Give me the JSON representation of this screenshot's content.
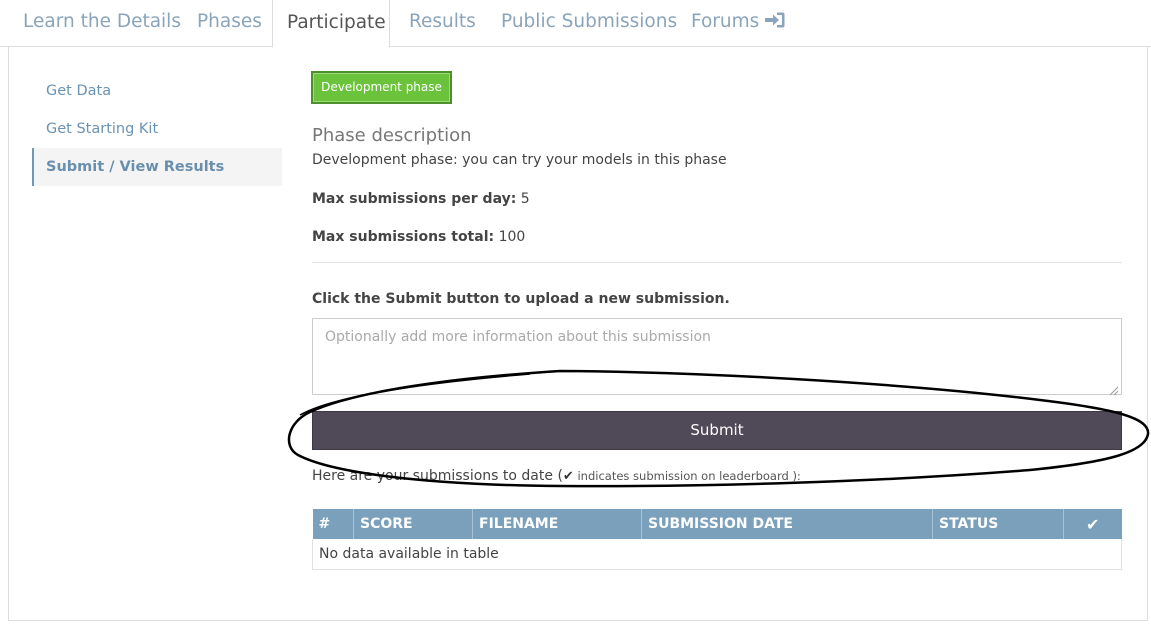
{
  "tabs": [
    {
      "label": "Learn the Details"
    },
    {
      "label": "Phases"
    },
    {
      "label": "Participate"
    },
    {
      "label": "Results"
    },
    {
      "label": "Public Submissions"
    },
    {
      "label": "Forums"
    }
  ],
  "active_tab": "Participate",
  "sidebar": {
    "items": [
      {
        "label": "Get Data"
      },
      {
        "label": "Get Starting Kit"
      },
      {
        "label": "Submit / View Results"
      }
    ],
    "active": "Submit / View Results"
  },
  "phase": {
    "badge_label": "Development phase",
    "badge_color": "#6ac33a",
    "description_title": "Phase description",
    "description": "Development phase: you can try your models in this phase",
    "max_per_day_label": "Max submissions per day:",
    "max_per_day_value": "5",
    "max_total_label": "Max submissions total:",
    "max_total_value": "100"
  },
  "submission": {
    "prompt": "Click the Submit button to upload a new submission.",
    "notes_placeholder": "Optionally add more information about this submission",
    "notes_value": "",
    "submit_label": "Submit",
    "submit_color": "#4f4958"
  },
  "submissions_table": {
    "intro_text": "Here are your submissions to date (",
    "intro_note": " indicates submission on leaderboard ):",
    "columns": [
      "#",
      "SCORE",
      "FILENAME",
      "SUBMISSION DATE",
      "STATUS"
    ],
    "leaderboard_column_icon": "checkmark-icon",
    "header_color": "#7aa0bc",
    "empty_message": "No data available in table"
  }
}
